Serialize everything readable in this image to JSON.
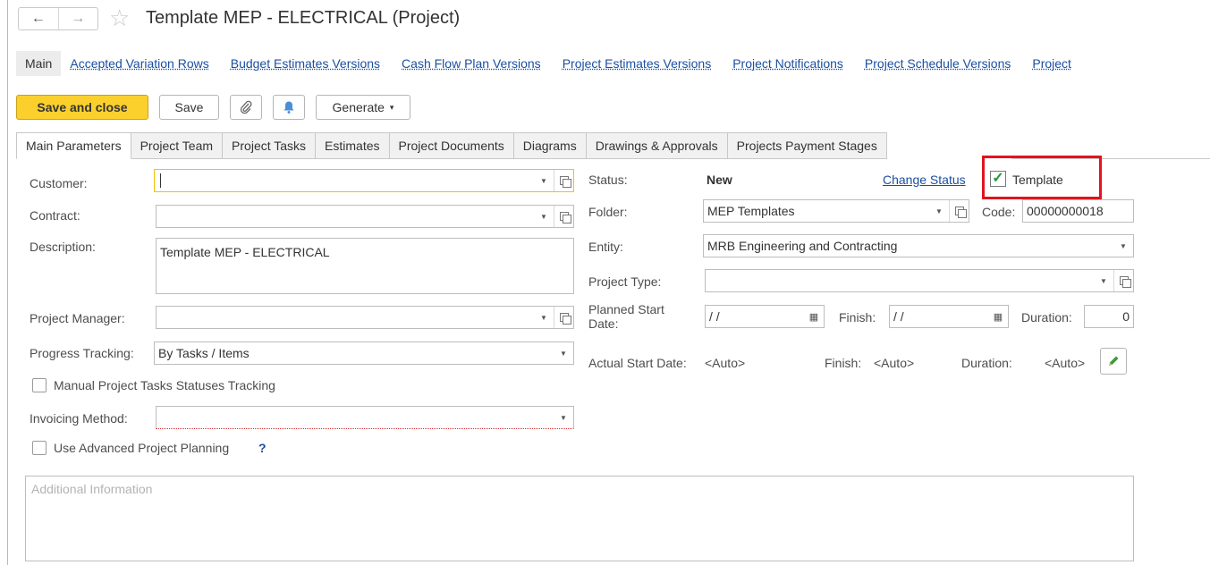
{
  "window": {
    "title": "Template MEP - ELECTRICAL (Project)"
  },
  "nav": {
    "main_label": "Main",
    "links": [
      "Accepted Variation Rows",
      "Budget Estimates Versions",
      "Cash Flow Plan Versions",
      "Project Estimates Versions",
      "Project Notifications",
      "Project Schedule Versions",
      "Project"
    ]
  },
  "toolbar": {
    "save_close": "Save and close",
    "save": "Save",
    "generate": "Generate"
  },
  "tabs": [
    "Main Parameters",
    "Project Team",
    "Project Tasks",
    "Estimates",
    "Project Documents",
    "Diagrams",
    "Drawings & Approvals",
    "Projects Payment Stages"
  ],
  "form": {
    "customer_label": "Customer:",
    "customer_value": "",
    "contract_label": "Contract:",
    "contract_value": "",
    "description_label": "Description:",
    "description_value": "Template MEP - ELECTRICAL",
    "pm_label": "Project Manager:",
    "pm_value": "",
    "progress_label": "Progress Tracking:",
    "progress_value": "By Tasks / Items",
    "manual_tracking_label": "Manual Project Tasks Statuses Tracking",
    "manual_tracking_checked": false,
    "invoicing_label": "Invoicing Method:",
    "invoicing_value": "",
    "advanced_planning_label": "Use Advanced Project Planning",
    "advanced_planning_help": "?",
    "additional_placeholder": "Additional Information",
    "status_label": "Status:",
    "status_value": "New",
    "change_status": "Change Status",
    "template_label": "Template",
    "template_checked": true,
    "folder_label": "Folder:",
    "folder_value": "MEP Templates",
    "code_label": "Code:",
    "code_value": "00000000018",
    "entity_label": "Entity:",
    "entity_value": "MRB Engineering and Contracting",
    "project_type_label": "Project Type:",
    "project_type_value": "",
    "planned_start_label_1": "Planned Start",
    "planned_start_label_2": "Date:",
    "planned_start_value": " / /",
    "finish_label": "Finish:",
    "finish_value": " / /",
    "duration_label": "Duration:",
    "duration_value": "0",
    "actual_start_label": "Actual Start Date:",
    "actual_start_value": "<Auto>",
    "actual_finish_label": "Finish:",
    "actual_finish_value": "<Auto>",
    "actual_duration_label": "Duration:",
    "actual_duration_value": "<Auto>"
  },
  "colors": {
    "primary_button": "#fbd02c",
    "link": "#1a4fa0",
    "highlight": "#e0141e",
    "check": "#1e9a3a"
  }
}
